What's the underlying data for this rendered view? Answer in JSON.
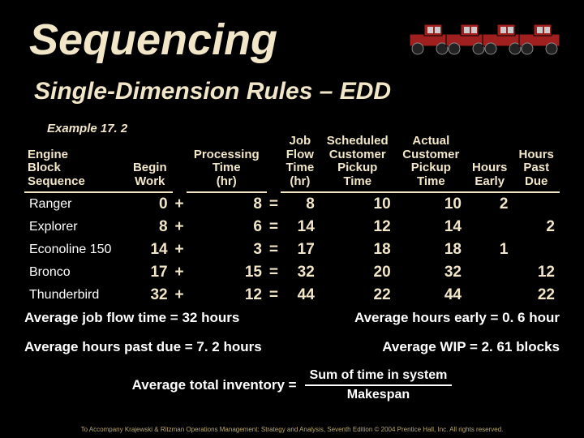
{
  "title": "Sequencing",
  "subtitle": "Single-Dimension Rules – EDD",
  "example": "Example 17. 2",
  "headers": {
    "name": "Engine\nBlock\nSequence",
    "begin": "Begin\nWork",
    "proc": "Processing\nTime\n(hr)",
    "flow": "Job\nFlow\nTime\n(hr)",
    "sched": "Scheduled\nCustomer\nPickup\nTime",
    "actual": "Actual\nCustomer\nPickup\nTime",
    "early": "Hours\nEarly",
    "past": "Hours\nPast\nDue"
  },
  "rows": [
    {
      "name": "Ranger",
      "begin": 0,
      "op1": "+",
      "proc": 8,
      "op2": "=",
      "flow": 8,
      "sched": 10,
      "actual": 10,
      "early": "2",
      "past": ""
    },
    {
      "name": "Explorer",
      "begin": 8,
      "op1": "+",
      "proc": 6,
      "op2": "=",
      "flow": 14,
      "sched": 12,
      "actual": 14,
      "early": "",
      "past": "2"
    },
    {
      "name": "Econoline 150",
      "begin": 14,
      "op1": "+",
      "proc": 3,
      "op2": "=",
      "flow": 17,
      "sched": 18,
      "actual": 18,
      "early": "1",
      "past": ""
    },
    {
      "name": "Bronco",
      "begin": 17,
      "op1": "+",
      "proc": 15,
      "op2": "=",
      "flow": 32,
      "sched": 20,
      "actual": 32,
      "early": "",
      "past": "12"
    },
    {
      "name": "Thunderbird",
      "begin": 32,
      "op1": "+",
      "proc": 12,
      "op2": "=",
      "flow": 44,
      "sched": 22,
      "actual": 44,
      "early": "",
      "past": "22"
    }
  ],
  "summary": {
    "avg_flow": "Average job flow time = 32 hours",
    "avg_early": "Average hours early = 0. 6 hour",
    "avg_past": "Average hours past due = 7. 2 hours",
    "avg_wip": "Average WIP = 2. 61 blocks",
    "avg_total_label": "Average total inventory =",
    "frac_num": "Sum of time in system",
    "frac_den": "Makespan"
  },
  "footer": "To Accompany Krajewski & Ritzman Operations Management: Strategy and Analysis, Seventh Edition © 2004 Prentice Hall, Inc. All rights reserved.",
  "chart_data": {
    "type": "table",
    "columns": [
      "Engine Block Sequence",
      "Begin Work",
      "Processing Time (hr)",
      "Job Flow Time (hr)",
      "Scheduled Customer Pickup Time",
      "Actual Customer Pickup Time",
      "Hours Early",
      "Hours Past Due"
    ],
    "rows": [
      [
        "Ranger",
        0,
        8,
        8,
        10,
        10,
        2,
        null
      ],
      [
        "Explorer",
        8,
        6,
        14,
        12,
        14,
        null,
        2
      ],
      [
        "Econoline 150",
        14,
        3,
        17,
        18,
        18,
        1,
        null
      ],
      [
        "Bronco",
        17,
        15,
        32,
        20,
        32,
        null,
        12
      ],
      [
        "Thunderbird",
        32,
        12,
        44,
        22,
        44,
        null,
        22
      ]
    ],
    "averages": {
      "job_flow_time_hr": 32,
      "hours_early": 0.6,
      "hours_past_due": 7.2,
      "wip_blocks": 2.61
    },
    "formula": "Average total inventory = Sum of time in system / Makespan"
  }
}
